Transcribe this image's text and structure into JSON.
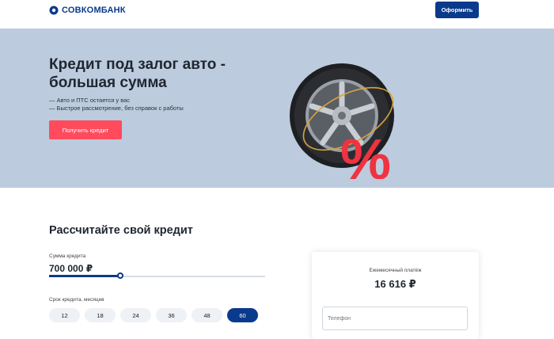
{
  "header": {
    "logo_text": "СОВКОМБАНК",
    "cta_label": "Оформить"
  },
  "hero": {
    "title": "Кредит под залог авто - большая сумма",
    "bullets": [
      "— Авто и ПТС остается у вас",
      "— Быстрое рассмотрение, без справок с работы"
    ],
    "button_label": "Получить кредит",
    "percent_glyph": "%"
  },
  "calculator": {
    "title": "Рассчитайте свой кредит",
    "sum_label": "Сумма кредита",
    "sum_value": "700 000 ₽",
    "sum_slider_fraction": 0.33,
    "term_label": "Срок кредита, месяцев",
    "terms": [
      "12",
      "18",
      "24",
      "36",
      "48",
      "60"
    ],
    "active_term": "60",
    "monthly_label": "Ежемесячный платёж",
    "monthly_value": "16 616 ₽",
    "phone_placeholder": "Телефон"
  },
  "colors": {
    "brand": "#0a3a8c",
    "accent": "#ff4b5c",
    "hero_bg": "#bccbdd"
  }
}
